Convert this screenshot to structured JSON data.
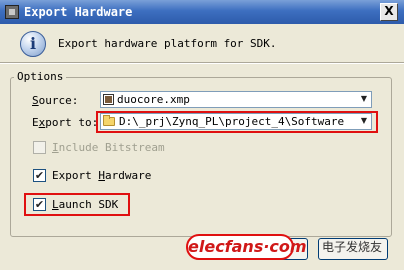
{
  "window": {
    "title": "Export Hardware",
    "close_label": "X"
  },
  "header": {
    "message": "Export hardware platform for SDK."
  },
  "options": {
    "group_label": "Options",
    "source": {
      "label_u": "S",
      "label_rest": "ource:",
      "value": "duocore.xmp"
    },
    "export_to": {
      "label_pre": "E",
      "label_u": "x",
      "label_rest": "port to:",
      "value": "D:\\_prj\\Zynq_PL\\project_4\\Software"
    },
    "include_bitstream": {
      "label_u": "I",
      "label_rest": "nclude Bitstream",
      "checked": false,
      "enabled": false
    },
    "export_hardware": {
      "label_pre": "Export ",
      "label_u": "H",
      "label_rest": "ardware",
      "checked": true
    },
    "launch_sdk": {
      "label_u": "L",
      "label_rest": "aunch SDK",
      "checked": true
    }
  },
  "watermark": {
    "logo": "elecfans·com",
    "text": "电子发烧友"
  },
  "colors": {
    "highlight": "#e01010",
    "titlebar": "#2d5bab"
  }
}
